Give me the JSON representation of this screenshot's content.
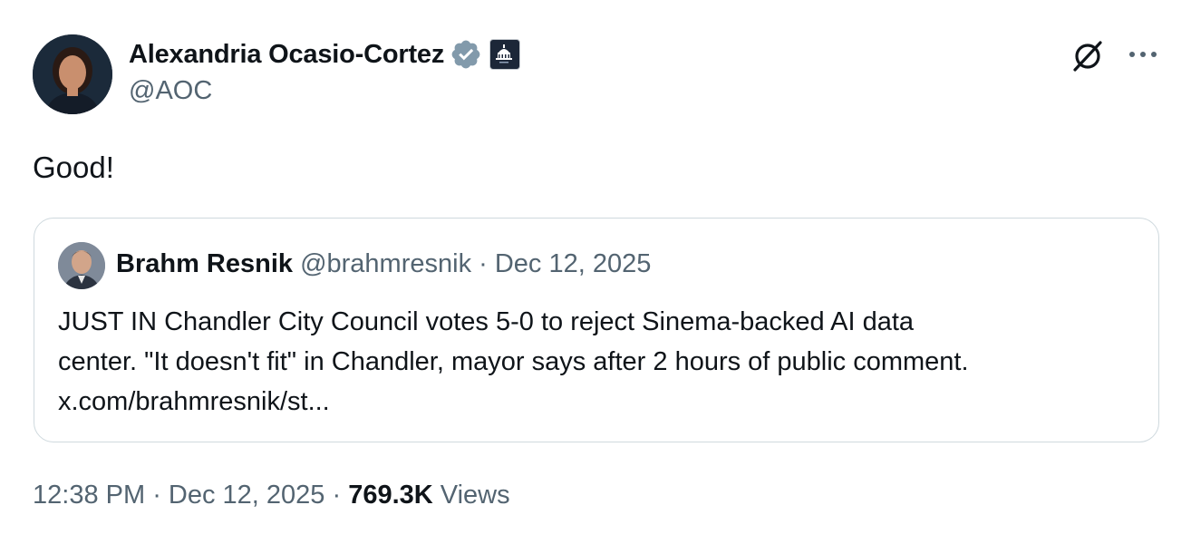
{
  "tweet": {
    "author": {
      "display_name": "Alexandria Ocasio-Cortez",
      "handle": "@AOC",
      "verified": true,
      "affiliation_badge": "capitol-icon"
    },
    "text": "Good!",
    "quoted_tweet": {
      "author_name": "Brahm Resnik",
      "author_handle": "@brahmresnik",
      "separator": " · ",
      "date": "Dec 12, 2025",
      "text_lines": [
        "JUST IN Chandler City Council votes 5-0 to reject Sinema-backed AI data",
        "center. \"It doesn't fit\" in Chandler, mayor says after 2 hours of public comment.",
        "x.com/brahmresnik/st..."
      ]
    },
    "footer": {
      "time": "12:38 PM",
      "separator": " · ",
      "date": "Dec 12, 2025",
      "views_count": "769.3K",
      "views_label": " Views"
    }
  },
  "icons": {
    "verified": "verified-badge-icon",
    "grok": "grok-icon",
    "more": "more-options-icon"
  },
  "colors": {
    "primary_text": "#0f1419",
    "secondary_text": "#536471",
    "border": "#cfd9de",
    "verified_badge": "#829aab"
  }
}
